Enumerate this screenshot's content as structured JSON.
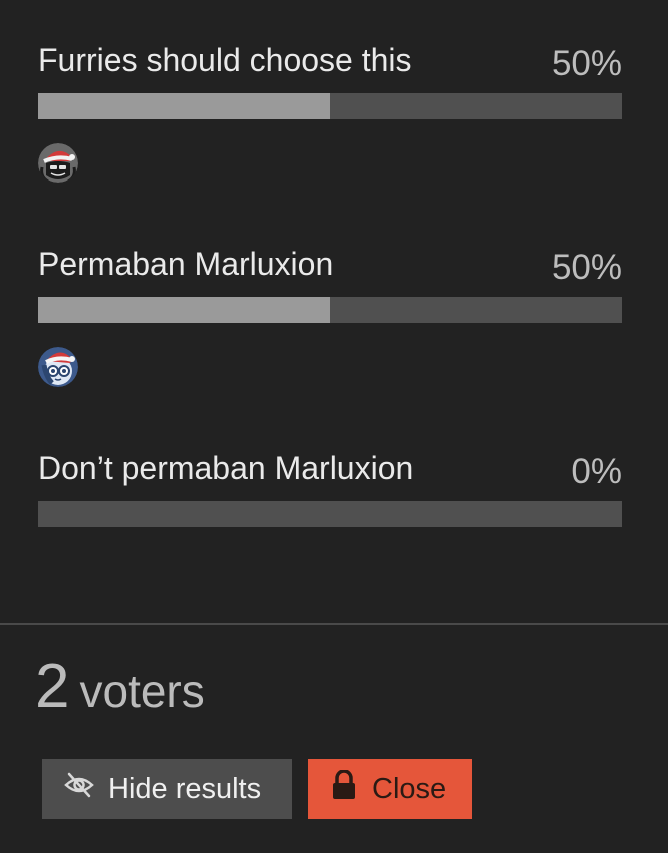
{
  "poll": {
    "options": [
      {
        "label": "Furries should choose this",
        "percent_text": "50%",
        "percent": 50,
        "voters": [
          {
            "avatar": "avatar-dark-santa-hat-icon"
          }
        ]
      },
      {
        "label": "Permaban Marluxion",
        "percent_text": "50%",
        "percent": 50,
        "voters": [
          {
            "avatar": "avatar-blue-glasses-santa-hat-icon"
          }
        ]
      },
      {
        "label": "Don’t permaban Marluxion",
        "percent_text": "0%",
        "percent": 0,
        "voters": []
      }
    ],
    "voter_count": "2",
    "voter_word": "voters"
  },
  "actions": {
    "hide_results_label": "Hide results",
    "hide_results_icon": "eye-slash-icon",
    "close_label": "Close",
    "close_icon": "lock-icon"
  },
  "colors": {
    "background": "#222222",
    "bar_track": "#505050",
    "bar_fill": "#9a9a9a",
    "close_button": "#e5563a",
    "hide_button": "#4d4d4d"
  }
}
